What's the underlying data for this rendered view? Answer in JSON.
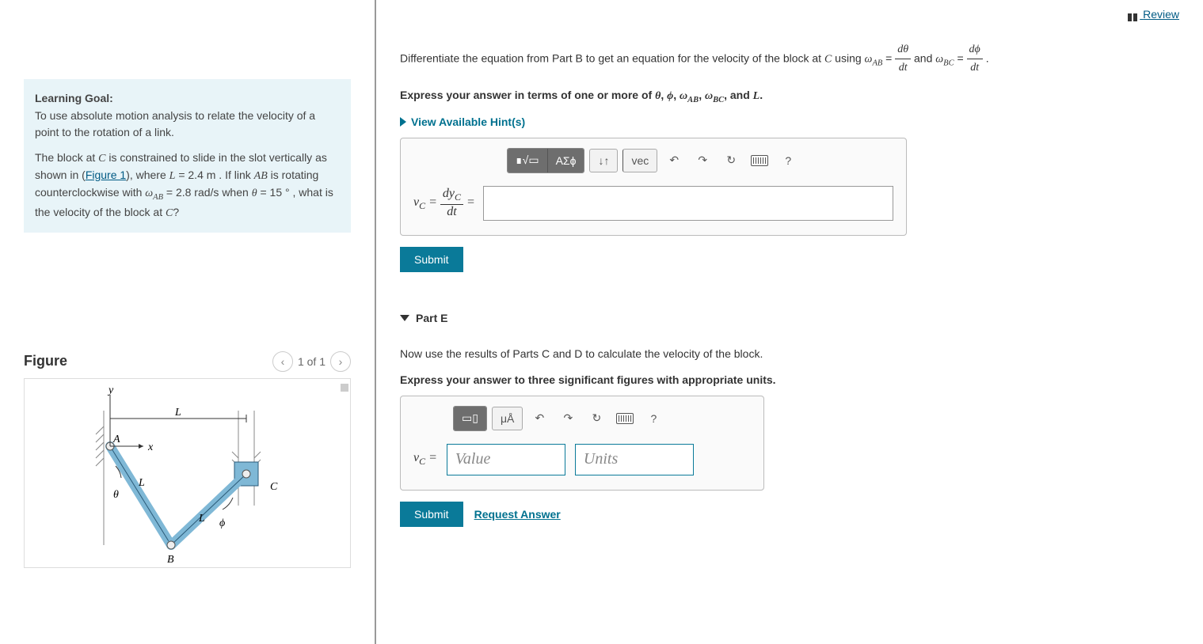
{
  "review_label": "Review",
  "learning_goal": {
    "heading": "Learning Goal:",
    "para1": "To use absolute motion analysis to relate the velocity of a point to the rotation of a link.",
    "para2_a": "The block at ",
    "para2_b": " is constrained to slide in the slot vertically as shown in (",
    "fig_link": "Figure 1",
    "para2_c": "), where ",
    "para2_d": " = 2.4 m . If link ",
    "para2_e": " is rotating counterclockwise with ",
    "para2_f": " = 2.8 rad/s when ",
    "para2_g": " = 15 ° , what is the velocity of the block at ",
    "para2_h": "?"
  },
  "figure": {
    "label": "Figure",
    "pager": "1 of 1",
    "labels": {
      "y": "y",
      "x": "x",
      "A": "A",
      "B": "B",
      "C": "C",
      "L1": "L",
      "L2": "L",
      "Ltop": "L",
      "theta": "θ",
      "phi": "ϕ"
    }
  },
  "partD": {
    "prompt_a": "Differentiate the equation from Part B to get an equation for the velocity of the block at ",
    "prompt_b": " using ",
    "prompt_c": " and ",
    "prompt_d": " .",
    "instruct_a": "Express your answer in terms of one or more of ",
    "instruct_b": ", and ",
    "instruct_c": ".",
    "hints": "View Available Hint(s)",
    "toolbar": {
      "templates": "∎√▭",
      "greek": "ΑΣϕ",
      "arrows": "↓↑",
      "vec": "vec",
      "undo": "↶",
      "redo": "↷",
      "reset": "↻",
      "help": "?"
    },
    "prefix_vc": "v",
    "prefix_sub": "C",
    "prefix_eq": " = ",
    "frac_num": "dy",
    "frac_sub": "C",
    "frac_den": "dt",
    "submit": "Submit"
  },
  "partE": {
    "header": "Part E",
    "prompt": "Now use the results of Parts C and D to calculate the velocity of the block.",
    "instruct": "Express your answer to three significant figures with appropriate units.",
    "toolbar": {
      "t1": "▭▯",
      "t2": "μÅ",
      "undo": "↶",
      "redo": "↷",
      "reset": "↻",
      "help": "?"
    },
    "prefix_vc": "v",
    "prefix_sub": "C",
    "prefix_eq": " = ",
    "value_ph": "Value",
    "units_ph": "Units",
    "submit": "Submit",
    "request": "Request Answer"
  },
  "math": {
    "C": "C",
    "L": "L",
    "AB": "AB",
    "omega": "ω",
    "omega_ab": "AB",
    "omega_bc": "BC",
    "theta": "θ",
    "phi": "ϕ",
    "dtheta": "dθ",
    "dphi": "dϕ",
    "dt": "dt"
  }
}
